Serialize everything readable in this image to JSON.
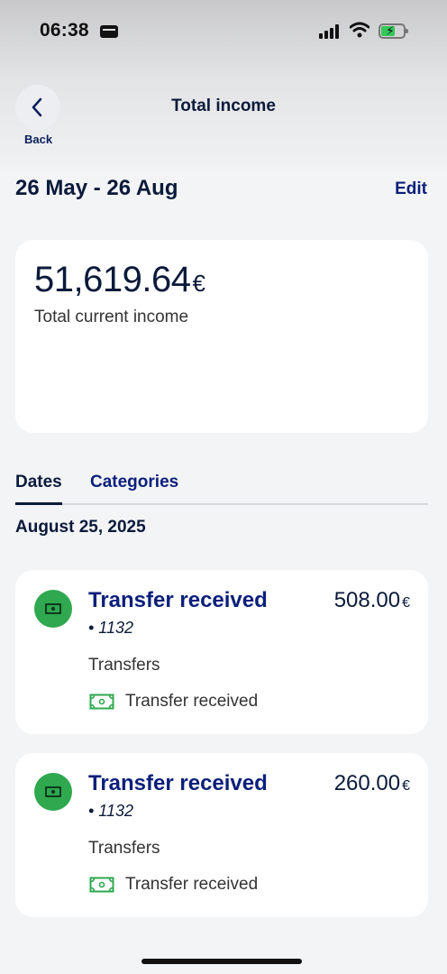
{
  "status_bar": {
    "time": "06:38"
  },
  "header": {
    "back_label": "Back",
    "title": "Total income"
  },
  "period": {
    "range": "26 May - 26 Aug",
    "edit_label": "Edit"
  },
  "summary": {
    "amount": "51,619.64",
    "currency": "€",
    "label": "Total current income"
  },
  "tabs": [
    {
      "label": "Dates",
      "active": true
    },
    {
      "label": "Categories",
      "active": false
    }
  ],
  "section_date": "August 25, 2025",
  "transactions": [
    {
      "title": "Transfer received",
      "account": "• 1132",
      "amount": "508.00",
      "currency": "€",
      "category": "Transfers",
      "tag": "Transfer received"
    },
    {
      "title": "Transfer received",
      "account": "• 1132",
      "amount": "260.00",
      "currency": "€",
      "category": "Transfers",
      "tag": "Transfer received"
    }
  ],
  "colors": {
    "accent_navy": "#0b1f7a",
    "income_green": "#2fa84f",
    "battery_green": "#35c759"
  },
  "icons": {
    "back": "chevron-left-icon",
    "transaction": "banknote-icon",
    "tag": "banknote-outline-icon"
  }
}
